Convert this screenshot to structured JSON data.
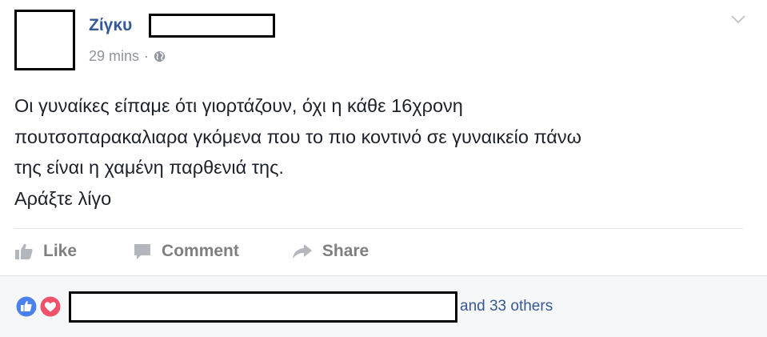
{
  "post": {
    "author_name": "Ζίγκυ",
    "timestamp": "29 mins",
    "meta_separator": "·",
    "privacy_icon": "globe-icon",
    "menu_icon": "chevron-down-icon",
    "text_lines": [
      "Οι γυναίκες είπαμε ότι γιορτάζουν, όχι η κάθε 16χρονη",
      "πουτσοπαρακαλιαρα γκόμενα που το πιο κοντινό σε γυναικείο πάνω",
      "της είναι η χαμένη παρθενιά της.",
      "Αράξτε λίγο"
    ]
  },
  "actions": {
    "like_label": "Like",
    "comment_label": "Comment",
    "share_label": "Share"
  },
  "reactions": {
    "icons": [
      "like-reaction-icon",
      "love-reaction-icon"
    ],
    "others_text": "and 33 others"
  },
  "colors": {
    "link_blue": "#365899",
    "like_blue": "#4a80f0",
    "love_red": "#f0526b",
    "meta_gray": "#90949c",
    "action_gray": "#7f7f7f"
  }
}
